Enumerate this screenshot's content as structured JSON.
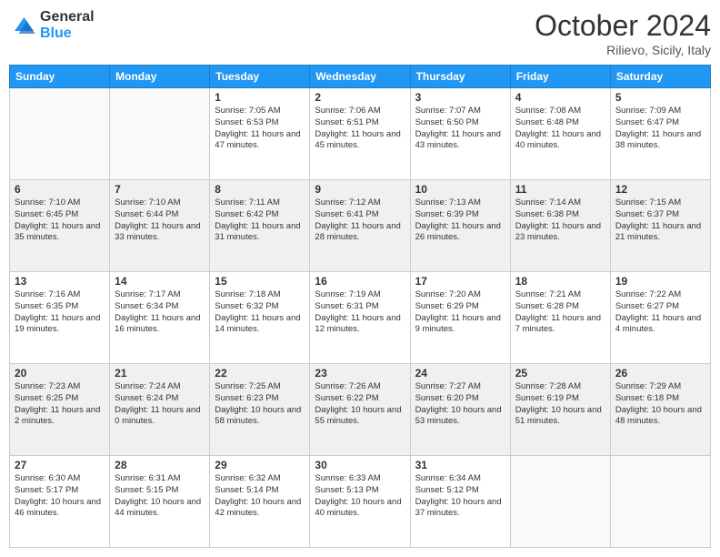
{
  "logo": {
    "line1": "General",
    "line2": "Blue"
  },
  "title": "October 2024",
  "location": "Rilievo, Sicily, Italy",
  "days_of_week": [
    "Sunday",
    "Monday",
    "Tuesday",
    "Wednesday",
    "Thursday",
    "Friday",
    "Saturday"
  ],
  "weeks": [
    [
      {
        "day": null
      },
      {
        "day": null
      },
      {
        "day": "1",
        "sunrise": "Sunrise: 7:05 AM",
        "sunset": "Sunset: 6:53 PM",
        "daylight": "Daylight: 11 hours and 47 minutes."
      },
      {
        "day": "2",
        "sunrise": "Sunrise: 7:06 AM",
        "sunset": "Sunset: 6:51 PM",
        "daylight": "Daylight: 11 hours and 45 minutes."
      },
      {
        "day": "3",
        "sunrise": "Sunrise: 7:07 AM",
        "sunset": "Sunset: 6:50 PM",
        "daylight": "Daylight: 11 hours and 43 minutes."
      },
      {
        "day": "4",
        "sunrise": "Sunrise: 7:08 AM",
        "sunset": "Sunset: 6:48 PM",
        "daylight": "Daylight: 11 hours and 40 minutes."
      },
      {
        "day": "5",
        "sunrise": "Sunrise: 7:09 AM",
        "sunset": "Sunset: 6:47 PM",
        "daylight": "Daylight: 11 hours and 38 minutes."
      }
    ],
    [
      {
        "day": "6",
        "sunrise": "Sunrise: 7:10 AM",
        "sunset": "Sunset: 6:45 PM",
        "daylight": "Daylight: 11 hours and 35 minutes."
      },
      {
        "day": "7",
        "sunrise": "Sunrise: 7:10 AM",
        "sunset": "Sunset: 6:44 PM",
        "daylight": "Daylight: 11 hours and 33 minutes."
      },
      {
        "day": "8",
        "sunrise": "Sunrise: 7:11 AM",
        "sunset": "Sunset: 6:42 PM",
        "daylight": "Daylight: 11 hours and 31 minutes."
      },
      {
        "day": "9",
        "sunrise": "Sunrise: 7:12 AM",
        "sunset": "Sunset: 6:41 PM",
        "daylight": "Daylight: 11 hours and 28 minutes."
      },
      {
        "day": "10",
        "sunrise": "Sunrise: 7:13 AM",
        "sunset": "Sunset: 6:39 PM",
        "daylight": "Daylight: 11 hours and 26 minutes."
      },
      {
        "day": "11",
        "sunrise": "Sunrise: 7:14 AM",
        "sunset": "Sunset: 6:38 PM",
        "daylight": "Daylight: 11 hours and 23 minutes."
      },
      {
        "day": "12",
        "sunrise": "Sunrise: 7:15 AM",
        "sunset": "Sunset: 6:37 PM",
        "daylight": "Daylight: 11 hours and 21 minutes."
      }
    ],
    [
      {
        "day": "13",
        "sunrise": "Sunrise: 7:16 AM",
        "sunset": "Sunset: 6:35 PM",
        "daylight": "Daylight: 11 hours and 19 minutes."
      },
      {
        "day": "14",
        "sunrise": "Sunrise: 7:17 AM",
        "sunset": "Sunset: 6:34 PM",
        "daylight": "Daylight: 11 hours and 16 minutes."
      },
      {
        "day": "15",
        "sunrise": "Sunrise: 7:18 AM",
        "sunset": "Sunset: 6:32 PM",
        "daylight": "Daylight: 11 hours and 14 minutes."
      },
      {
        "day": "16",
        "sunrise": "Sunrise: 7:19 AM",
        "sunset": "Sunset: 6:31 PM",
        "daylight": "Daylight: 11 hours and 12 minutes."
      },
      {
        "day": "17",
        "sunrise": "Sunrise: 7:20 AM",
        "sunset": "Sunset: 6:29 PM",
        "daylight": "Daylight: 11 hours and 9 minutes."
      },
      {
        "day": "18",
        "sunrise": "Sunrise: 7:21 AM",
        "sunset": "Sunset: 6:28 PM",
        "daylight": "Daylight: 11 hours and 7 minutes."
      },
      {
        "day": "19",
        "sunrise": "Sunrise: 7:22 AM",
        "sunset": "Sunset: 6:27 PM",
        "daylight": "Daylight: 11 hours and 4 minutes."
      }
    ],
    [
      {
        "day": "20",
        "sunrise": "Sunrise: 7:23 AM",
        "sunset": "Sunset: 6:25 PM",
        "daylight": "Daylight: 11 hours and 2 minutes."
      },
      {
        "day": "21",
        "sunrise": "Sunrise: 7:24 AM",
        "sunset": "Sunset: 6:24 PM",
        "daylight": "Daylight: 11 hours and 0 minutes."
      },
      {
        "day": "22",
        "sunrise": "Sunrise: 7:25 AM",
        "sunset": "Sunset: 6:23 PM",
        "daylight": "Daylight: 10 hours and 58 minutes."
      },
      {
        "day": "23",
        "sunrise": "Sunrise: 7:26 AM",
        "sunset": "Sunset: 6:22 PM",
        "daylight": "Daylight: 10 hours and 55 minutes."
      },
      {
        "day": "24",
        "sunrise": "Sunrise: 7:27 AM",
        "sunset": "Sunset: 6:20 PM",
        "daylight": "Daylight: 10 hours and 53 minutes."
      },
      {
        "day": "25",
        "sunrise": "Sunrise: 7:28 AM",
        "sunset": "Sunset: 6:19 PM",
        "daylight": "Daylight: 10 hours and 51 minutes."
      },
      {
        "day": "26",
        "sunrise": "Sunrise: 7:29 AM",
        "sunset": "Sunset: 6:18 PM",
        "daylight": "Daylight: 10 hours and 48 minutes."
      }
    ],
    [
      {
        "day": "27",
        "sunrise": "Sunrise: 6:30 AM",
        "sunset": "Sunset: 5:17 PM",
        "daylight": "Daylight: 10 hours and 46 minutes."
      },
      {
        "day": "28",
        "sunrise": "Sunrise: 6:31 AM",
        "sunset": "Sunset: 5:15 PM",
        "daylight": "Daylight: 10 hours and 44 minutes."
      },
      {
        "day": "29",
        "sunrise": "Sunrise: 6:32 AM",
        "sunset": "Sunset: 5:14 PM",
        "daylight": "Daylight: 10 hours and 42 minutes."
      },
      {
        "day": "30",
        "sunrise": "Sunrise: 6:33 AM",
        "sunset": "Sunset: 5:13 PM",
        "daylight": "Daylight: 10 hours and 40 minutes."
      },
      {
        "day": "31",
        "sunrise": "Sunrise: 6:34 AM",
        "sunset": "Sunset: 5:12 PM",
        "daylight": "Daylight: 10 hours and 37 minutes."
      },
      {
        "day": null
      },
      {
        "day": null
      }
    ]
  ]
}
